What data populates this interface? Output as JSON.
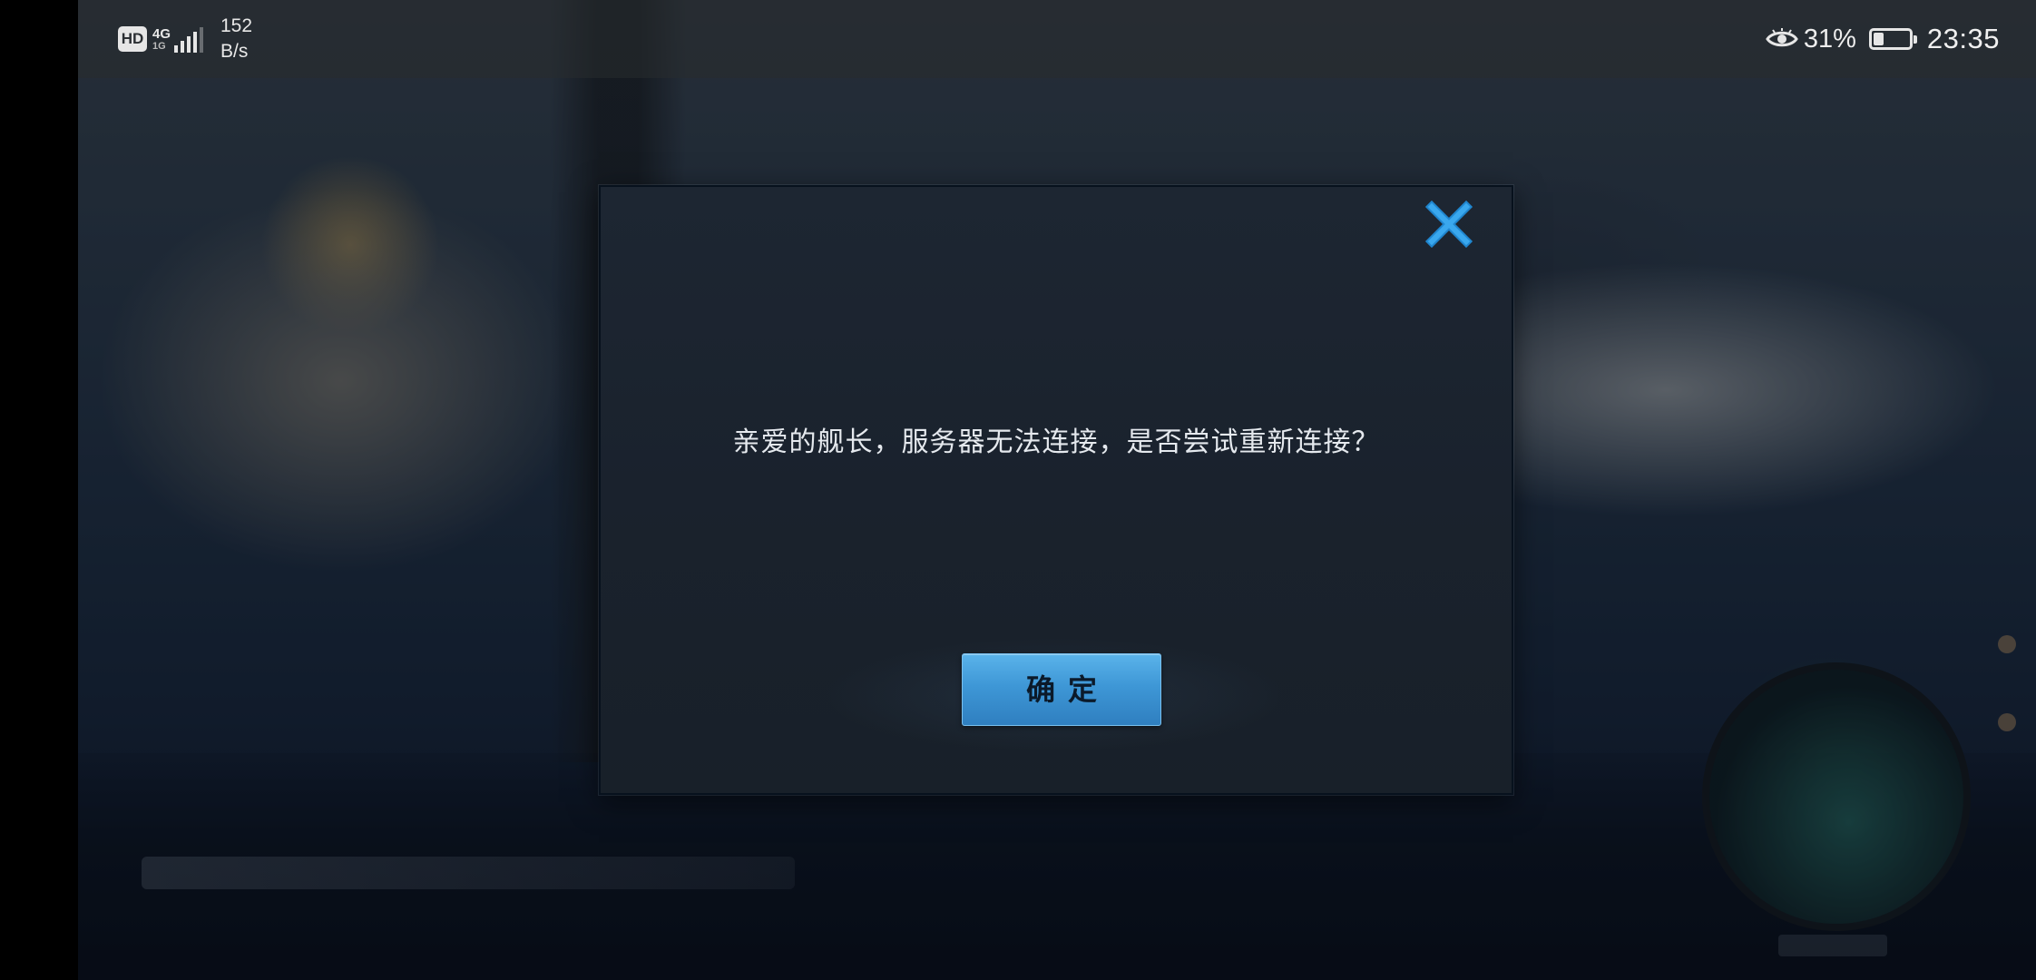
{
  "status_bar": {
    "hd_badge": "HD",
    "network_type": "4G",
    "network_sub": "1G",
    "signal_level": 4,
    "speed_value": "152",
    "speed_unit": "B/s",
    "eye_icon": "eye-comfort-icon",
    "battery_percent": "31%",
    "battery_level": 0.31,
    "time": "23:35"
  },
  "dialog": {
    "message": "亲爱的舰长，服务器无法连接，是否尝试重新连接？",
    "confirm_label": "确定",
    "close_icon": "close-icon"
  },
  "colors": {
    "accent_blue": "#3e97d6",
    "close_icon_blue": "#2f9de3",
    "dialog_bg": "#1b2430"
  }
}
